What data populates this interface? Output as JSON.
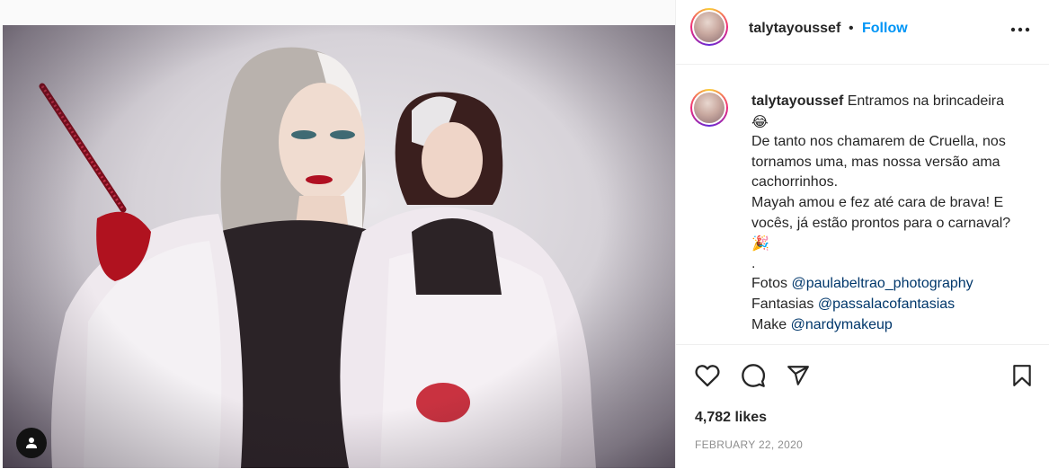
{
  "post": {
    "image_alt": "",
    "user_tags_icon": "person-icon"
  },
  "header": {
    "username": "talytayoussef",
    "separator": "•",
    "follow_label": "Follow",
    "more_icon": "more-horizontal-icon"
  },
  "caption": {
    "username": "talytayoussef",
    "lines": [
      "Entramos na brincadeira",
      "😂",
      "De tanto nos chamarem de Cruella, nos",
      "tornamos uma, mas nossa versão ama",
      "cachorrinhos.",
      "Mayah amou e fez até cara de brava! E",
      "vocês, já estão prontos para o carnaval?",
      "🎉",
      "."
    ],
    "credits": [
      {
        "label": "Fotos",
        "mention": "@paulabeltrao_photography"
      },
      {
        "label": "Fantasias",
        "mention": "@passalacofantasias"
      },
      {
        "label": "Make",
        "mention": "@nardymakeup"
      }
    ]
  },
  "actions": {
    "like_icon": "heart-icon",
    "comment_icon": "comment-icon",
    "share_icon": "paper-plane-icon",
    "save_icon": "bookmark-icon"
  },
  "stats": {
    "likes": "4,782 likes",
    "date": "FEBRUARY 22, 2020"
  },
  "colors": {
    "follow": "#0095f6",
    "mention": "#00376b",
    "text": "#262626",
    "muted": "#8e8e8e",
    "border": "#efefef"
  }
}
